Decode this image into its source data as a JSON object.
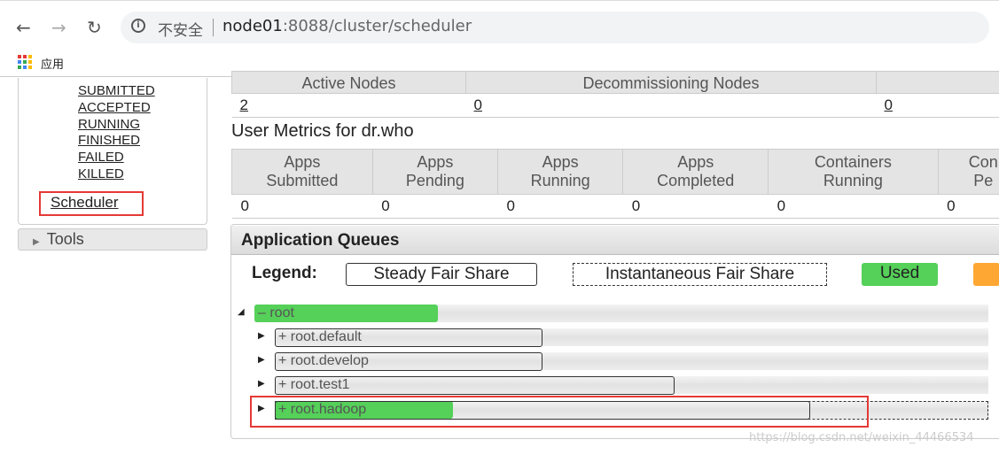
{
  "browser": {
    "security": "不安全",
    "url_host": "node01",
    "url_rest": ":8088/cluster/scheduler",
    "bookmark_apps": "应用"
  },
  "sidebar": {
    "app_states": [
      "SUBMITTED",
      "ACCEPTED",
      "RUNNING",
      "FINISHED",
      "FAILED",
      "KILLED"
    ],
    "scheduler": "Scheduler",
    "tools": "Tools"
  },
  "cluster_metrics": {
    "headers": [
      "Active Nodes",
      "Decommissioning Nodes",
      ""
    ],
    "values": [
      "2",
      "0",
      "0"
    ]
  },
  "user_metrics": {
    "title": "User Metrics for dr.who",
    "headers": [
      [
        "Apps",
        "Submitted"
      ],
      [
        "Apps",
        "Pending"
      ],
      [
        "Apps",
        "Running"
      ],
      [
        "Apps",
        "Completed"
      ],
      [
        "Containers",
        "Running"
      ],
      [
        "Con",
        "Pe"
      ]
    ],
    "values": [
      "0",
      "0",
      "0",
      "0",
      "0",
      "0"
    ]
  },
  "queues": {
    "title": "Application Queues",
    "legend_label": "Legend:",
    "legend": {
      "steady": "Steady Fair Share",
      "instant": "Instantaneous Fair Share",
      "used": "Used"
    },
    "colors": {
      "used": "#55d059",
      "over": "#ffa733",
      "highlight": "#e53935"
    },
    "items": [
      {
        "name": "root",
        "expanded": true,
        "used": 0.25
      },
      {
        "name": "root.default",
        "expanded": false,
        "steady": 0.375,
        "instant": 0,
        "used": 0
      },
      {
        "name": "root.develop",
        "expanded": false,
        "steady": 0.375,
        "instant": 0,
        "used": 0
      },
      {
        "name": "root.test1",
        "expanded": false,
        "steady": 0.56,
        "instant": 0,
        "used": 0
      },
      {
        "name": "root.hadoop",
        "expanded": false,
        "steady": 0.75,
        "instant": 1.0,
        "used": 0.25
      }
    ]
  },
  "watermark": "https://blog.csdn.net/weixin_44466534"
}
